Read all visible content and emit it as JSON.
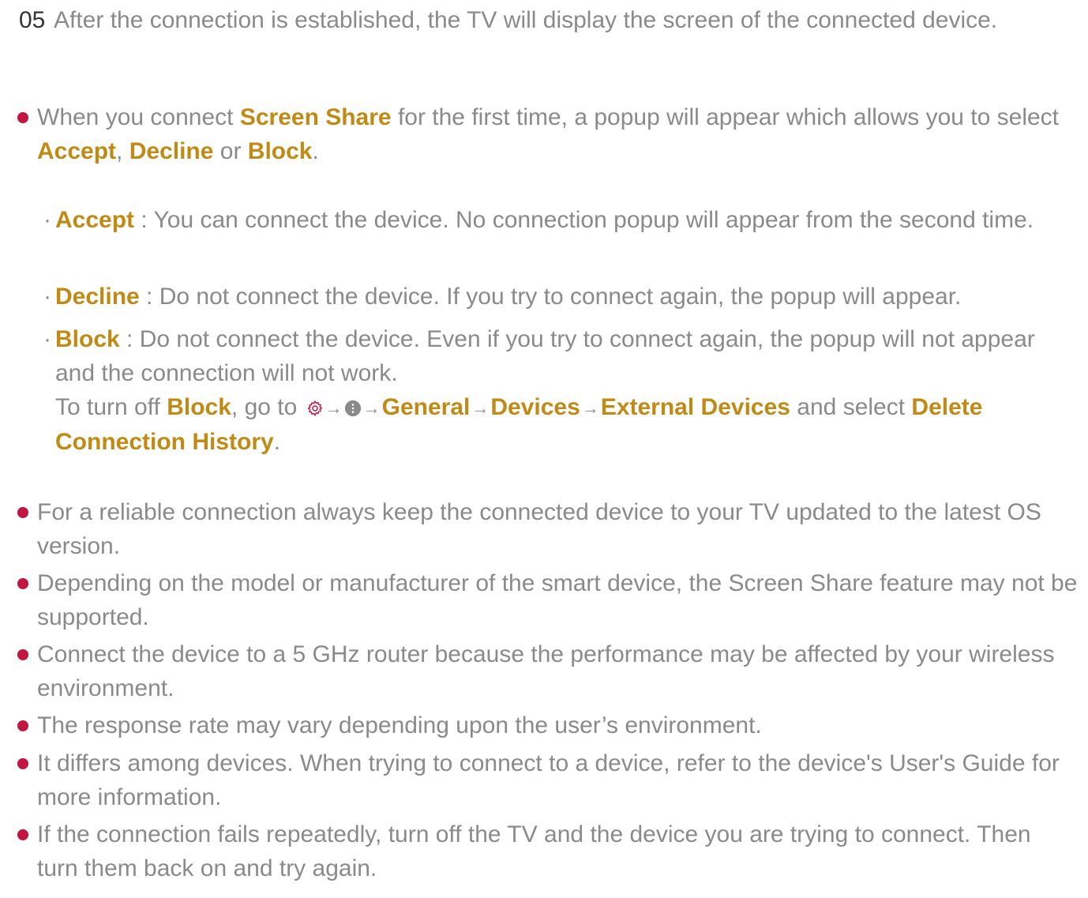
{
  "step": {
    "number": "05",
    "text": "After the connection is established, the TV will display the screen of the connected device."
  },
  "bullet1": {
    "pre": "When you connect ",
    "screen_share": "Screen Share",
    "mid": " for the first time, a popup will appear which allows you to select ",
    "accept": "Accept",
    "comma": ", ",
    "decline": "Decline",
    "or": " or ",
    "block": "Block",
    "end": "."
  },
  "sub_items": [
    {
      "marker": "·",
      "term": "Accept",
      "text": " : You can connect the device. No connection popup will appear from the second time."
    },
    {
      "marker": "·",
      "term": "Decline",
      "text": " : Do not connect the device. If you try to connect again, the popup will appear."
    },
    {
      "marker": "·",
      "term": "Block",
      "text": " : Do not connect the device. Even if you try to connect again, the popup will not appear and the connection will not work."
    }
  ],
  "block_path": {
    "pre": "To turn off ",
    "block": "Block",
    "goto": ", go to ",
    "gear_icon": "settings-gear-icon",
    "menu_icon": "more-menu-icon",
    "arrow": "→",
    "general": "General",
    "devices": "Devices",
    "external": "External Devices",
    "and_select": " and select ",
    "delete": "Delete Connection History",
    "end": "."
  },
  "notes": [
    "For a reliable connection always keep the connected device to your TV updated to the latest OS version.",
    "Depending on the model or manufacturer of the smart device, the Screen Share feature may not be supported.",
    "Connect the device to a 5 GHz router because the performance may be affected by your wireless environment.",
    "The response rate may vary depending upon the user’s environment.",
    "It differs among devices. When trying to connect to a device, refer to the device's User's Guide for more information.",
    "If the connection fails repeatedly, turn off the TV and the device you are trying to connect. Then turn them back on and try again."
  ],
  "colors": {
    "accent": "#c08a14",
    "bullet": "#c0163f",
    "body_text": "#8a8a8a",
    "step_number": "#333333"
  }
}
